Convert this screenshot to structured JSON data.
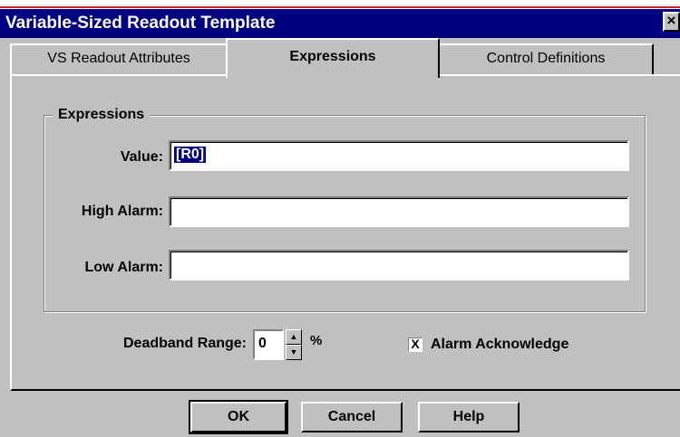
{
  "window": {
    "title": "Variable-Sized Readout Template",
    "close_label": "×"
  },
  "tabs": [
    {
      "label": "VS Readout Attributes",
      "active": false
    },
    {
      "label": "Expressions",
      "active": true
    },
    {
      "label": "Control Definitions",
      "active": false
    }
  ],
  "group": {
    "title": "Expressions",
    "fields": [
      {
        "label": "Value:",
        "value": "[R0]"
      },
      {
        "label": "High Alarm:",
        "value": ""
      },
      {
        "label": "Low Alarm:",
        "value": ""
      }
    ]
  },
  "deadband": {
    "label": "Deadband Range:",
    "value": "0",
    "unit": "%"
  },
  "alarm_ack": {
    "label": "Alarm Acknowledge",
    "checked": true,
    "mark": "X"
  },
  "buttons": {
    "ok": "OK",
    "cancel": "Cancel",
    "help": "Help"
  },
  "colors": {
    "titlebar": "#000080",
    "face": "#c0c0c0"
  }
}
